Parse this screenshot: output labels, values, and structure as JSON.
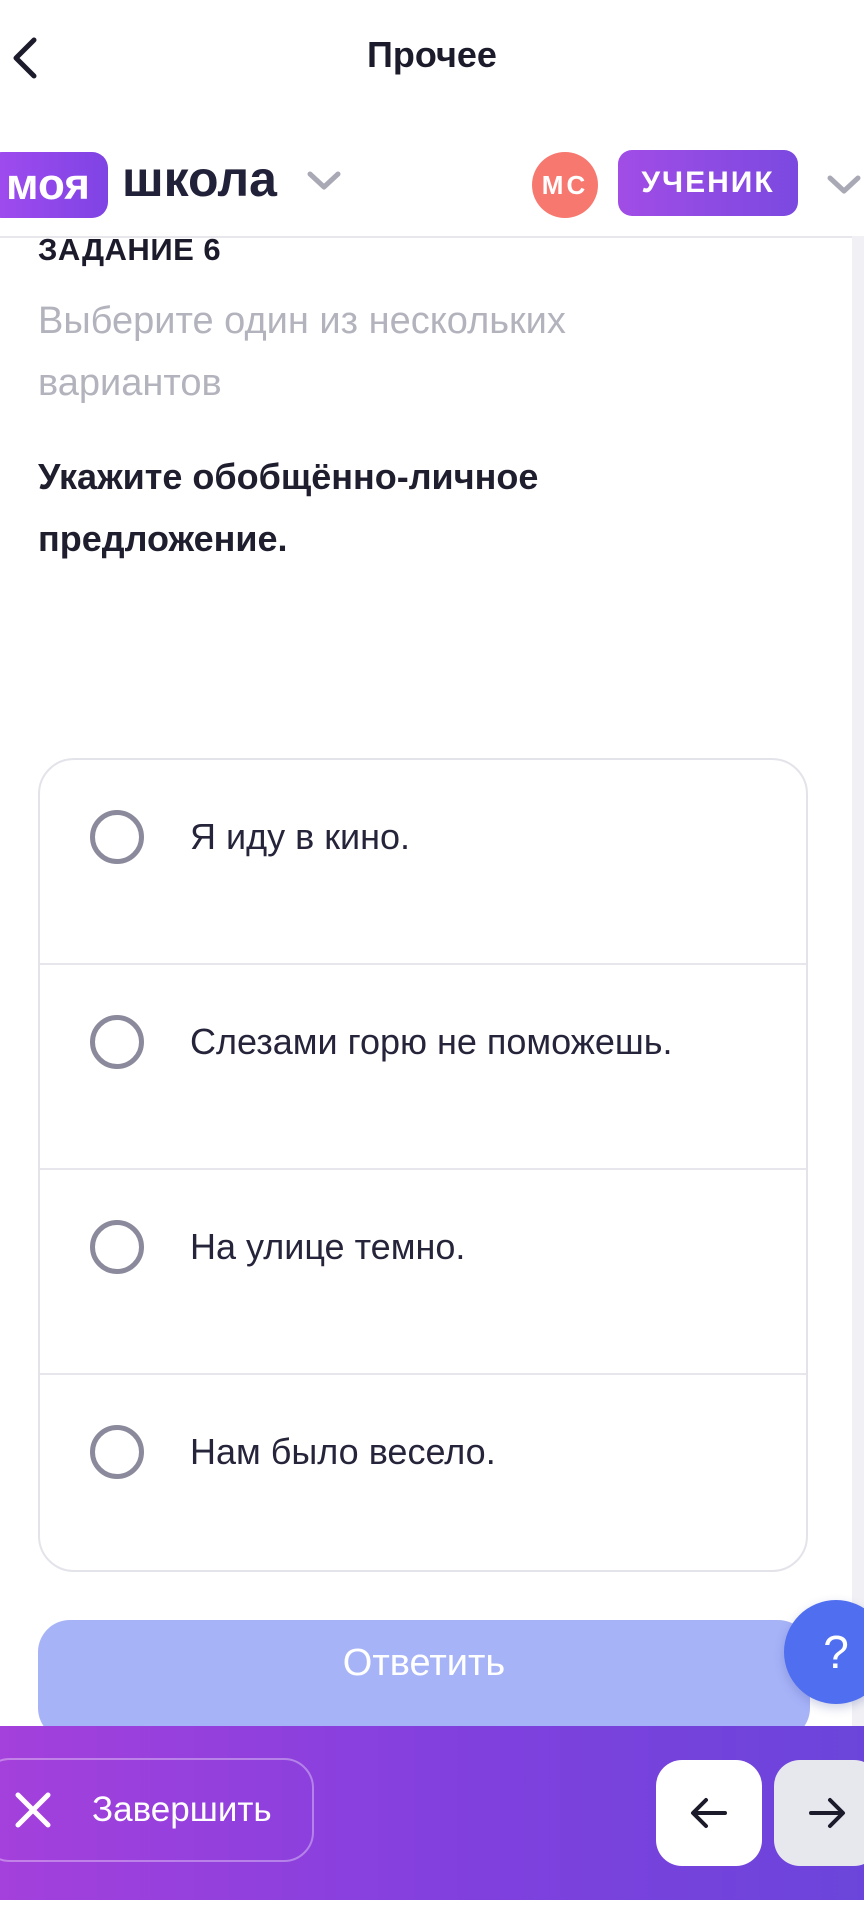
{
  "nav": {
    "title": "Прочее",
    "back_icon": "chevron-left-icon"
  },
  "header": {
    "logo_badge": "моя",
    "logo_word": "школа",
    "avatar_initials": "МС",
    "role": "УЧЕНИК",
    "accent_color": "#8a47e6",
    "avatar_color": "#f7786f"
  },
  "task": {
    "label": "ЗАДАНИЕ 6",
    "hint": "Выберите один из нескольких вариантов",
    "question": "Укажите обобщённо-личное предложение."
  },
  "options": [
    {
      "label": "Я иду в кино.",
      "selected": false
    },
    {
      "label": "Слезами горю не поможешь.",
      "selected": false
    },
    {
      "label": "На улице темно.",
      "selected": false
    },
    {
      "label": "Нам было весело.",
      "selected": false
    }
  ],
  "submit": {
    "label": "Ответить",
    "enabled": false,
    "color": "#a7b3f7"
  },
  "help": {
    "label": "?",
    "color": "#4f6ef0"
  },
  "bottom_bar": {
    "finish_label": "Завершить",
    "finish_icon": "close-icon",
    "prev_icon": "arrow-left-icon",
    "next_icon": "arrow-right-icon"
  }
}
